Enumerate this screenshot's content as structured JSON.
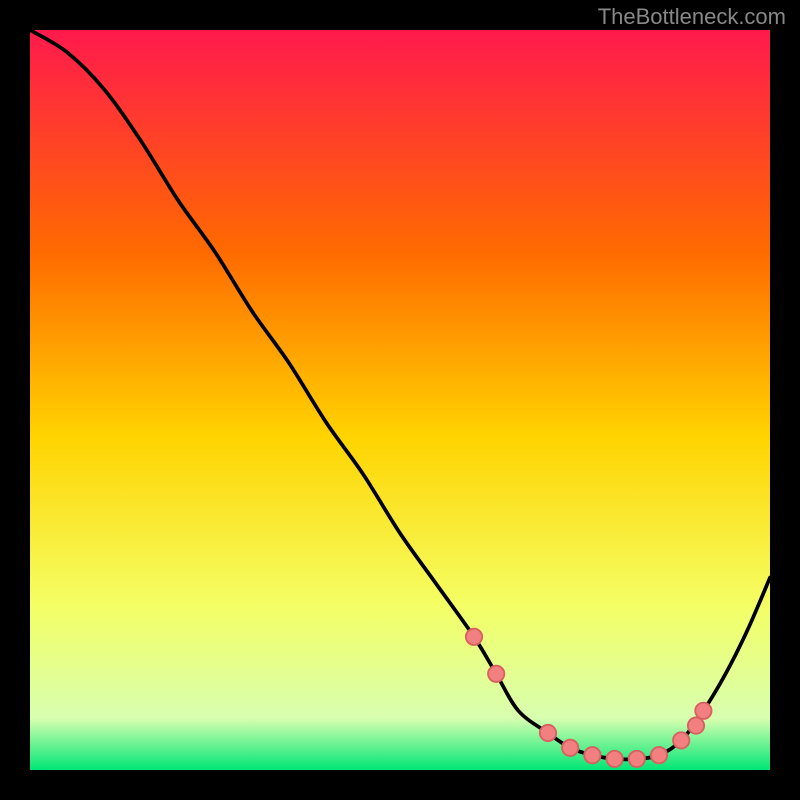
{
  "watermark": "TheBottleneck.com",
  "colors": {
    "bg": "#000000",
    "top": "#ff1a4d",
    "mid_upper": "#ff6a00",
    "mid": "#ffd400",
    "mid_lower": "#f4ff66",
    "low": "#d8ffb0",
    "bottom": "#00e676",
    "line": "#000000",
    "dot": "#f28080",
    "dot_stroke": "#d86060"
  },
  "chart_data": {
    "type": "line",
    "title": "",
    "xlabel": "",
    "ylabel": "",
    "xlim": [
      0,
      100
    ],
    "ylim": [
      0,
      100
    ],
    "x": [
      0,
      5,
      10,
      15,
      20,
      25,
      30,
      35,
      40,
      45,
      50,
      55,
      60,
      63,
      66,
      70,
      73,
      76,
      79,
      82,
      85,
      88,
      91,
      94,
      97,
      100
    ],
    "y": [
      100,
      97,
      92,
      85,
      77,
      70,
      62,
      55,
      47,
      40,
      32,
      25,
      18,
      13,
      8,
      5,
      3,
      2,
      1.5,
      1.5,
      2,
      4,
      8,
      13,
      19,
      26
    ],
    "markers": {
      "x": [
        60,
        63,
        70,
        73,
        76,
        79,
        82,
        85,
        88,
        90,
        91
      ],
      "y": [
        18,
        13,
        5,
        3,
        2,
        1.5,
        1.5,
        2,
        4,
        6,
        8
      ]
    }
  }
}
